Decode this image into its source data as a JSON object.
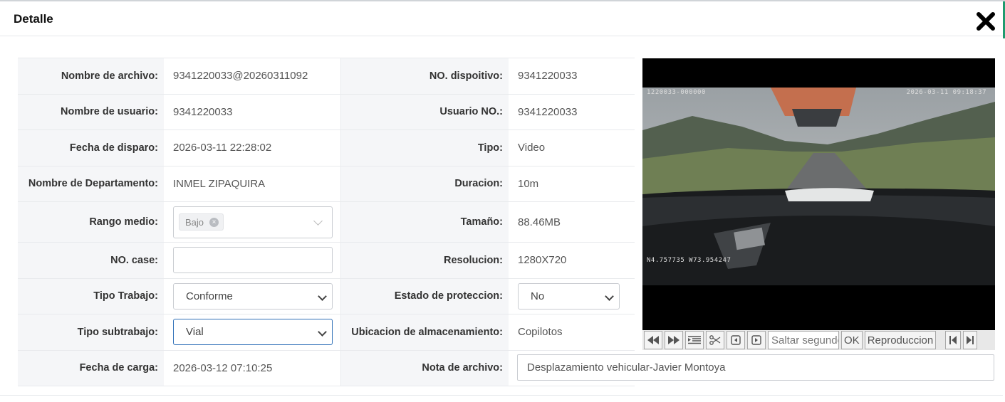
{
  "dialog": {
    "title": "Detalle"
  },
  "fields": {
    "nombre_archivo": {
      "label": "Nombre de archivo:",
      "value": "9341220033@20260311092"
    },
    "nombre_usuario": {
      "label": "Nombre de usuario:",
      "value": "9341220033"
    },
    "fecha_disparo": {
      "label": "Fecha de disparo:",
      "value": "2026-03-11 22:28:02"
    },
    "departamento": {
      "label": "Nombre de Departamento:",
      "value": "INMEL ZIPAQUIRA"
    },
    "rango_medio": {
      "label": "Rango medio:",
      "tag": "Bajo"
    },
    "no_case": {
      "label": "NO. case:",
      "value": ""
    },
    "tipo_trabajo": {
      "label": "Tipo Trabajo:",
      "value": "Conforme"
    },
    "tipo_subtrabajo": {
      "label": "Tipo subtrabajo:",
      "value": "Vial"
    },
    "fecha_carga": {
      "label": "Fecha de carga:",
      "value": "2026-03-12 07:10:25"
    },
    "no_dispositivo": {
      "label": "NO. dispoitivo:",
      "value": "9341220033"
    },
    "usuario_no": {
      "label": "Usuario NO.:",
      "value": "9341220033"
    },
    "tipo": {
      "label": "Tipo:",
      "value": "Video"
    },
    "duracion": {
      "label": "Duracion:",
      "value": "10m"
    },
    "tamano": {
      "label": "Tamaño:",
      "value": "88.46MB"
    },
    "resolucion": {
      "label": "Resolucion:",
      "value": "1280X720"
    },
    "estado_proteccion": {
      "label": "Estado de proteccion:",
      "value": "No"
    },
    "ubicacion": {
      "label": "Ubicacion de almacenamiento:",
      "value": "Copilotos"
    },
    "nota_archivo": {
      "label": "Nota de archivo:",
      "value": "Desplazamiento vehicular-Javier Montoya"
    }
  },
  "video": {
    "osd_left": "1220033-000000",
    "osd_right": "2026-03-11 09:18:37",
    "osd_gps": "N4.757735  W73.954247"
  },
  "player_controls": {
    "seek_placeholder": "Saltar segundo",
    "ok_label": "OK",
    "play_label": "Reproduccion"
  }
}
